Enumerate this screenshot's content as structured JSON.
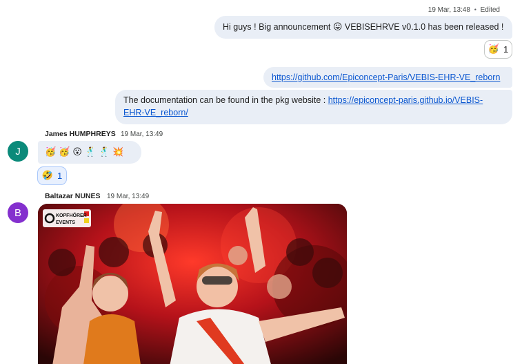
{
  "messages": {
    "own_meta": {
      "time": "19 Mar, 13:48",
      "separator": "•",
      "edited": "Edited"
    },
    "own_msg1": {
      "before": "Hi guys ! Big announcement",
      "emoji": "😛",
      "after": "VEBISEHRVE v0.1.0 has been released !"
    },
    "own_msg1_reaction": {
      "emoji": "🥳",
      "count": "1"
    },
    "own_msg2": {
      "link": "https://github.com/Epiconcept-Paris/VEBIS-EHR-VE_reborn"
    },
    "own_msg3": {
      "text": "The documentation can be found in the pkg website :",
      "link_part1": "https://epiconcept-paris.github.io/VEBIS-",
      "link_part2": "EHR-VE_reborn/"
    },
    "james": {
      "initial": "J",
      "avatar_color": "#0b8a7a",
      "name": "James HUMPHREYS",
      "time": "19 Mar, 13:49",
      "emojis": [
        "🥳",
        "🥳",
        "😮",
        "🕺",
        "🕺",
        "💥"
      ],
      "reaction": {
        "emoji": "🤣",
        "count": "1"
      }
    },
    "baltazar": {
      "initial": "B",
      "avatar_color": "#8430ce",
      "name": "Baltazar NUNES",
      "time": "19 Mar, 13:49",
      "photo_logo_line1": "KOPFHÖRER",
      "photo_logo_line2": "EVENTS"
    }
  }
}
